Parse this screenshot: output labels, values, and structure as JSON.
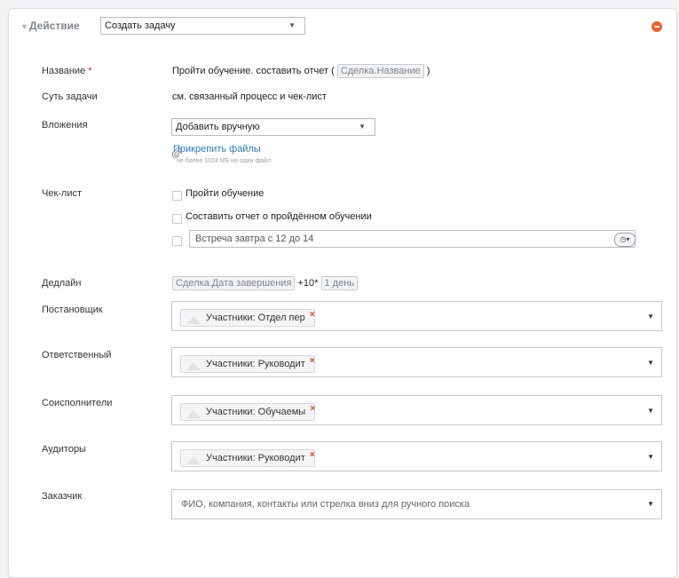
{
  "action": {
    "label": "Действие",
    "select_value": "Создать задачу"
  },
  "fields": {
    "title_label": "Название",
    "required_mark": "*",
    "title_prefix": "Пройти обучение. составить отчет (",
    "title_token": "Сделка.Название",
    "title_suffix": ")",
    "essence_label": "Суть задачи",
    "essence_value": "см. связанный процесс и чек-лист",
    "attachments_label": "Вложения",
    "attachments_select": "Добавить вручную",
    "attach_link": "Прикрепить файлы",
    "attach_hint": "не более 1024 МБ на один файл",
    "checklist_label": "Чек-лист",
    "checklist_items": [
      "Пройти обучение",
      "Составить отчет о пройдённом обучении"
    ],
    "checklist_input_value": "Встреча завтра с 12 до 14",
    "deadline_label": "Дедлайн",
    "deadline_token": "Сделка.Дата завершения",
    "deadline_offset": "+10*",
    "deadline_period": "1 день",
    "creator_label": "Постановщик",
    "creator_chip": "Участники: Отдел пер",
    "responsible_label": "Ответственный",
    "responsible_chip": "Участники: Руководит",
    "coexecutors_label": "Соисполнители",
    "coexecutors_chip": "Участники: Обучаемы",
    "auditors_label": "Аудиторы",
    "auditors_chip": "Участники: Руководит",
    "customer_label": "Заказчик",
    "customer_placeholder": "ФИО, компания, контакты или стрелка вниз для ручного поиска"
  },
  "glyphs": {
    "caret": "▼",
    "collapse_arrow": "▼",
    "chip_remove": "×",
    "clock": "◷▾"
  },
  "colors": {
    "link": "#2b79c4",
    "remove": "#f05e2c",
    "required": "#e02020"
  }
}
